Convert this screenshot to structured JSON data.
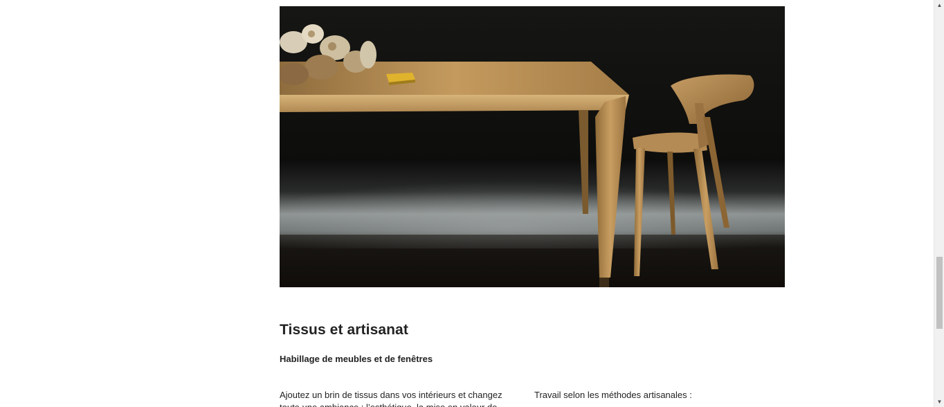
{
  "hero": {
    "image_name": "oak-table-and-chair-photo"
  },
  "section": {
    "title": "Tissus et artisanat",
    "subheading": "Habillage de meubles et de fenêtres",
    "left_paragraph": "Ajoutez un brin de tissus dans vos intérieurs et changez toute une ambiance : l’esthétique, la mise en valeur de mobilier ou",
    "right_paragraph": "Travail selon les méthodes artisanales :"
  },
  "scrollbar": {
    "up_icon": "▲",
    "down_icon": "▼"
  },
  "colors": {
    "background": "#ffffff",
    "text": "#222222",
    "photo_dark": "#0f0f0d",
    "oak": "#c49a5e"
  }
}
